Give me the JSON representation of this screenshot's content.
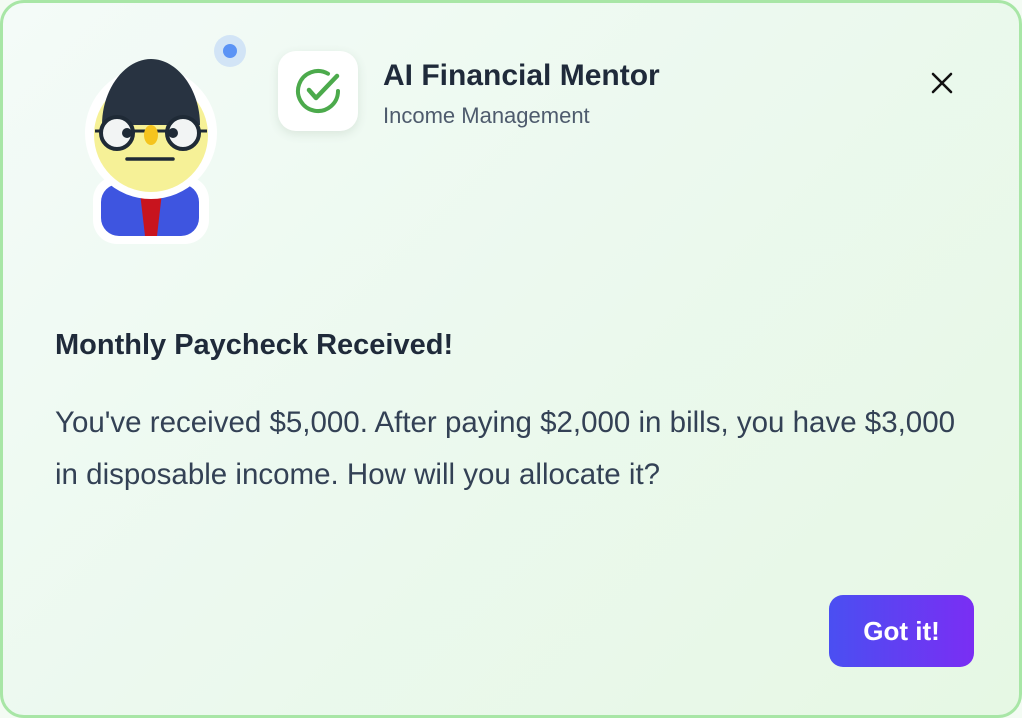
{
  "header": {
    "title": "AI Financial Mentor",
    "subtitle": "Income Management"
  },
  "message": {
    "heading": "Monthly Paycheck Received!",
    "body": "You've received $5,000. After paying $2,000 in bills, you have $3,000 in disposable income. How will you allocate it?"
  },
  "actions": {
    "confirm_label": "Got it!"
  },
  "icons": {
    "avatar": "mentor-avatar-icon",
    "status": "online-status-dot",
    "app": "checkmark-circle-icon",
    "close": "close-icon"
  },
  "colors": {
    "accent_start": "#4a4ff2",
    "accent_end": "#7a2ef3",
    "success_green": "#4caa4c",
    "border_green": "#a8e6a6",
    "status_blue": "#5b93f5"
  }
}
